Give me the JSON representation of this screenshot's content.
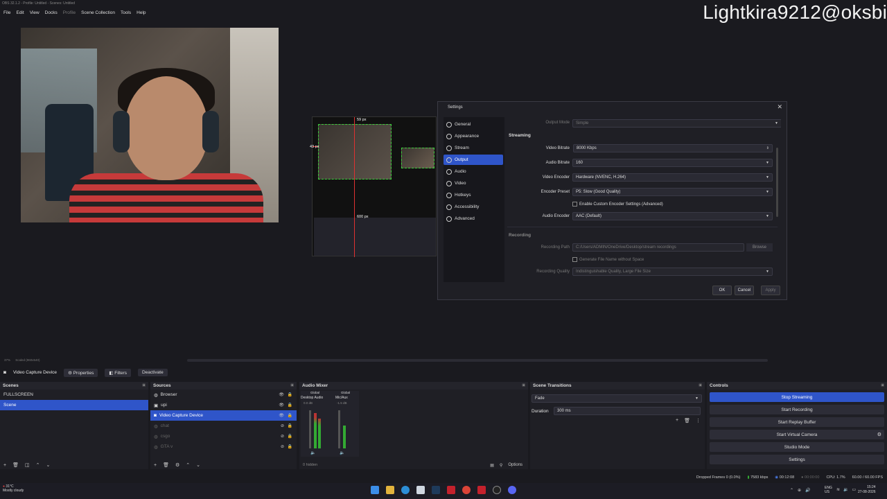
{
  "window": {
    "title": "OBS 32.1.2 - Profile: Untitled - Scenes: Untitled"
  },
  "menu": [
    "File",
    "Edit",
    "View",
    "Docks",
    "Profile",
    "Scene Collection",
    "Tools",
    "Help"
  ],
  "watermark": "Lightkira9212@oksbi",
  "preview": {
    "labels": {
      "top_px": "59 px",
      "left_px": "43 px",
      "bottom_px": "600 px"
    }
  },
  "settings_dialog": {
    "title": "Settings",
    "nav": [
      "General",
      "Appearance",
      "Stream",
      "Output",
      "Audio",
      "Video",
      "Hotkeys",
      "Accessibility",
      "Advanced"
    ],
    "active_nav": "Output",
    "output_mode_label": "Output Mode",
    "output_mode_value": "Simple",
    "streaming_section": "Streaming",
    "video_bitrate_label": "Video Bitrate",
    "video_bitrate_value": "8000 Kbps",
    "audio_bitrate_label": "Audio Bitrate",
    "audio_bitrate_value": "160",
    "video_encoder_label": "Video Encoder",
    "video_encoder_value": "Hardware (NVENC, H.264)",
    "encoder_preset_label": "Encoder Preset",
    "encoder_preset_value": "P5: Slow (Good Quality)",
    "custom_encoder_label": "Enable Custom Encoder Settings (Advanced)",
    "audio_encoder_label": "Audio Encoder",
    "audio_encoder_value": "AAC (Default)",
    "recording_section": "Recording",
    "recording_path_label": "Recording Path",
    "recording_path_value": "C:/Users/ADMIN/OneDrive/Desktop/stream recordings",
    "browse_label": "Browse",
    "gen_filename_label": "Generate File Name without Space",
    "recording_quality_label": "Recording Quality",
    "recording_quality_value": "Indistinguishable Quality, Large File Size",
    "ok": "OK",
    "cancel": "Cancel",
    "apply": "Apply"
  },
  "zoom": {
    "value": "37%",
    "text": "Scaled (960x540)"
  },
  "context_bar": {
    "source": "Video Capture Device",
    "properties": "Properties",
    "filters": "Filters",
    "deactivate": "Deactivate"
  },
  "scenes": {
    "title": "Scenes",
    "items": [
      "FULLSCREEN",
      "Scene"
    ],
    "selected": 1
  },
  "sources": {
    "title": "Sources",
    "items": [
      {
        "label": "Browser",
        "dim": false
      },
      {
        "label": "upi",
        "dim": false
      },
      {
        "label": "Video Capture Device",
        "dim": false
      },
      {
        "label": "chat",
        "dim": true
      },
      {
        "label": "csgo",
        "dim": true
      },
      {
        "label": "GTA v",
        "dim": true
      }
    ],
    "selected": 2
  },
  "mixer": {
    "title": "Audio Mixer",
    "channels": [
      {
        "scope": "Global",
        "name": "Desktop Audio",
        "db": "0.0 dB"
      },
      {
        "scope": "Global",
        "name": "Mic/Aux",
        "db": "-1.5 dB"
      }
    ],
    "hidden": "0 hidden",
    "options": "Options"
  },
  "transitions": {
    "title": "Scene Transitions",
    "type": "Fade",
    "duration_label": "Duration",
    "duration_value": "300 ms"
  },
  "controls": {
    "title": "Controls",
    "buttons": [
      "Stop Streaming",
      "Start Recording",
      "Start Replay Buffer",
      "Start Virtual Camera",
      "Studio Mode",
      "Settings"
    ]
  },
  "status": {
    "dropped": "Dropped Frames 0 (0.0%)",
    "kbps": "7583 kbps",
    "stream_time": "00:12:08",
    "rec_time": "00:00:00",
    "cpu": "CPU: 1.7%",
    "fps": "60.00 / 60.00 FPS"
  },
  "taskbar": {
    "weather_temp": "31°C",
    "weather_desc": "Mostly cloudy",
    "lang": "ENG",
    "region": "US",
    "time": "15:24",
    "date": "27-08-2026"
  },
  "colors": {
    "accent": "#2f55c9",
    "background": "#1a1a1f",
    "dock": "#1f1f25"
  }
}
